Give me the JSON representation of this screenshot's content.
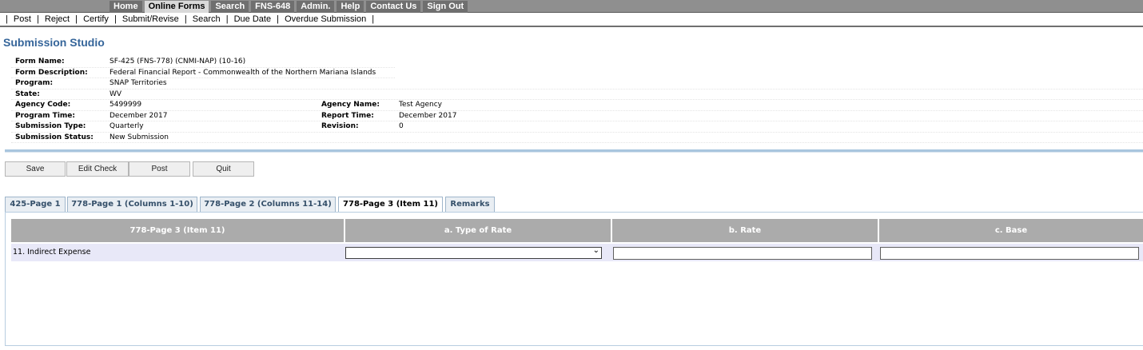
{
  "topnav": [
    "Home",
    "Online Forms",
    "Search",
    "FNS-648",
    "Admin.",
    "Help",
    "Contact Us",
    "Sign Out"
  ],
  "actions": [
    "Post",
    "Reject",
    "Certify",
    "Submit/Revise",
    "Search",
    "Due Date",
    "Overdue Submission"
  ],
  "page_title": "Submission Studio",
  "info": {
    "form_name_label": "Form Name:",
    "form_name": "SF-425 (FNS-778) (CNMI-NAP) (10-16)",
    "form_desc_label": "Form Description:",
    "form_desc": "Federal Financial Report - Commonwealth of the Northern Mariana Islands",
    "program_label": "Program:",
    "program": "SNAP Territories",
    "state_label": "State:",
    "state": "WV",
    "agency_code_label": "Agency Code:",
    "agency_code": "5499999",
    "agency_name_label": "Agency Name:",
    "agency_name": "Test Agency",
    "program_time_label": "Program Time:",
    "program_time": "December 2017",
    "report_time_label": "Report Time:",
    "report_time": "December 2017",
    "submission_type_label": "Submission Type:",
    "submission_type": "Quarterly",
    "revision_label": "Revision:",
    "revision": "0",
    "submission_status_label": "Submission Status:",
    "submission_status": "New Submission"
  },
  "buttons": [
    "Save",
    "Edit Check",
    "Post",
    "Quit"
  ],
  "tabs": [
    "425-Page 1",
    "778-Page 1 (Columns 1-10)",
    "778-Page 2 (Columns 11-14)",
    "778-Page 3 (Item 11)",
    "Remarks"
  ],
  "table": {
    "headers": [
      "778-Page 3 (Item 11)",
      "a. Type of Rate",
      "b. Rate",
      "c. Base"
    ],
    "row_label": "11. Indirect Expense",
    "type_of_rate_value": "",
    "rate_value": "",
    "base_value": ""
  }
}
